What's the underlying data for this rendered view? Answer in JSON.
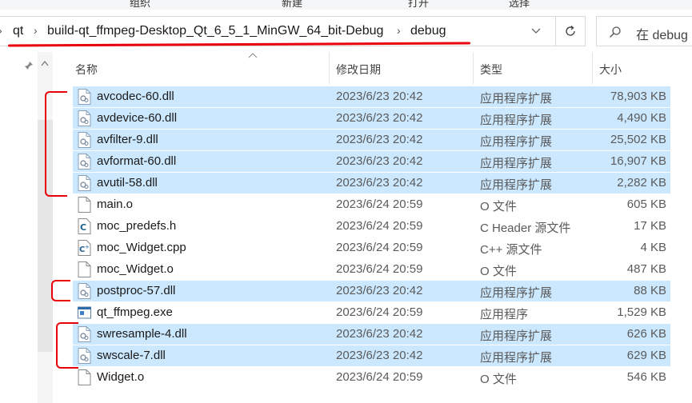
{
  "ribbon": {
    "labels": [
      "组织",
      "新建",
      "打开",
      "选择"
    ]
  },
  "address": {
    "crumbs": [
      "qt",
      "build-qt_ffmpeg-Desktop_Qt_6_5_1_MinGW_64_bit-Debug",
      "debug"
    ],
    "search_text": "在 debug"
  },
  "columns": {
    "name": "名称",
    "date": "修改日期",
    "type": "类型",
    "size": "大小"
  },
  "files": [
    {
      "name": "avcodec-60.dll",
      "date": "2023/6/23 20:42",
      "type": "应用程序扩展",
      "size": "78,903 KB",
      "icon": "dll-icon",
      "selected": true
    },
    {
      "name": "avdevice-60.dll",
      "date": "2023/6/23 20:42",
      "type": "应用程序扩展",
      "size": "4,490 KB",
      "icon": "dll-icon",
      "selected": true
    },
    {
      "name": "avfilter-9.dll",
      "date": "2023/6/23 20:42",
      "type": "应用程序扩展",
      "size": "25,502 KB",
      "icon": "dll-icon",
      "selected": true
    },
    {
      "name": "avformat-60.dll",
      "date": "2023/6/23 20:42",
      "type": "应用程序扩展",
      "size": "16,907 KB",
      "icon": "dll-icon",
      "selected": true
    },
    {
      "name": "avutil-58.dll",
      "date": "2023/6/23 20:42",
      "type": "应用程序扩展",
      "size": "2,282 KB",
      "icon": "dll-icon",
      "selected": true
    },
    {
      "name": "main.o",
      "date": "2023/6/24 20:59",
      "type": "O 文件",
      "size": "605 KB",
      "icon": "file-icon",
      "selected": false
    },
    {
      "name": "moc_predefs.h",
      "date": "2023/6/24 20:59",
      "type": "C Header 源文件",
      "size": "17 KB",
      "icon": "c-header-icon",
      "selected": false
    },
    {
      "name": "moc_Widget.cpp",
      "date": "2023/6/24 20:59",
      "type": "C++ 源文件",
      "size": "4 KB",
      "icon": "cpp-file-icon",
      "selected": false
    },
    {
      "name": "moc_Widget.o",
      "date": "2023/6/24 20:59",
      "type": "O 文件",
      "size": "487 KB",
      "icon": "file-icon",
      "selected": false
    },
    {
      "name": "postproc-57.dll",
      "date": "2023/6/23 20:42",
      "type": "应用程序扩展",
      "size": "88 KB",
      "icon": "dll-icon",
      "selected": true
    },
    {
      "name": "qt_ffmpeg.exe",
      "date": "2023/6/24 20:59",
      "type": "应用程序",
      "size": "1,529 KB",
      "icon": "exe-icon",
      "selected": false
    },
    {
      "name": "swresample-4.dll",
      "date": "2023/6/23 20:42",
      "type": "应用程序扩展",
      "size": "626 KB",
      "icon": "dll-icon",
      "selected": true
    },
    {
      "name": "swscale-7.dll",
      "date": "2023/6/23 20:42",
      "type": "应用程序扩展",
      "size": "629 KB",
      "icon": "dll-icon",
      "selected": true
    },
    {
      "name": "Widget.o",
      "date": "2023/6/24 20:59",
      "type": "O 文件",
      "size": "546 KB",
      "icon": "file-icon",
      "selected": false
    }
  ],
  "colors": {
    "selection": "#cce8ff",
    "annotation_red": "#e8000b"
  }
}
